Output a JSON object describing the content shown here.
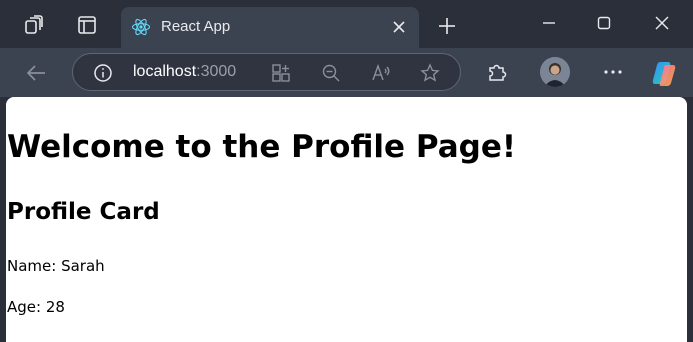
{
  "browser": {
    "tab": {
      "title": "React App",
      "favicon": "react-logo-icon"
    },
    "address": {
      "host": "localhost",
      "port": ":3000"
    },
    "icons": {
      "workspaces": "workspaces-icon",
      "tab_actions": "tab-actions-icon",
      "close_tab": "close-icon",
      "new_tab": "plus-icon",
      "minimize": "minimize-icon",
      "maximize": "maximize-icon",
      "close_window": "close-icon",
      "back": "arrow-left-icon",
      "site_info": "info-icon",
      "app_available": "apps-icon",
      "zoom": "zoom-out-icon",
      "read_aloud": "read-aloud-icon",
      "favorite": "star-icon",
      "extensions": "puzzle-icon",
      "more": "more-icon",
      "copilot": "copilot-icon"
    },
    "colors": {
      "frame": "#2b2f3a",
      "toolbar": "#3b4250",
      "page_bg": "#ffffff"
    }
  },
  "page": {
    "heading": "Welcome to the Profile Page!",
    "card_title": "Profile Card",
    "name_line": "Name: Sarah",
    "age_line": "Age: 28"
  }
}
